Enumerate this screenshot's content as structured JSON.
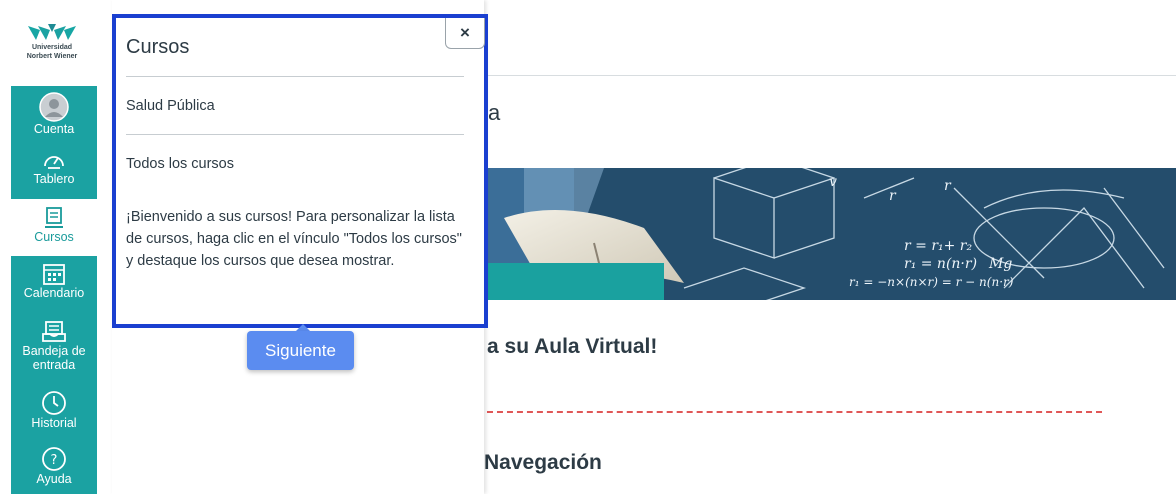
{
  "logo": {
    "line1": "Universidad",
    "line2": "Norbert Wiener"
  },
  "nav": [
    {
      "label": "Cuenta",
      "icon": "account-avatar-icon",
      "active": false
    },
    {
      "label": "Tablero",
      "icon": "dashboard-gauge-icon",
      "active": false
    },
    {
      "label": "Cursos",
      "icon": "courses-book-icon",
      "active": true
    },
    {
      "label": "Calendario",
      "icon": "calendar-icon",
      "active": false
    },
    {
      "label": "Bandeja de entrada",
      "icon": "inbox-icon",
      "active": false
    },
    {
      "label": "Historial",
      "icon": "history-clock-icon",
      "active": false
    },
    {
      "label": "Ayuda",
      "icon": "help-question-icon",
      "active": false
    }
  ],
  "tray": {
    "title": "Cursos",
    "close_label": "×",
    "course": "Salud Pública",
    "all_courses": "Todos los cursos",
    "help": "¡Bienvenido a sus cursos! Para personalizar la lista de cursos, haga clic en el vínculo \"Todos los cursos\" y destaque los cursos que desea mostrar."
  },
  "tour": {
    "next_label": "Siguiente"
  },
  "main": {
    "title_partial": "a",
    "welcome_partial": "a su Aula Virtual!",
    "nav_heading_partial": "Navegación"
  },
  "colors": {
    "nav_bg": "#1ba2a2",
    "highlight": "#1a3fd0",
    "button": "#5b8cf0",
    "divider": "#e05757"
  }
}
